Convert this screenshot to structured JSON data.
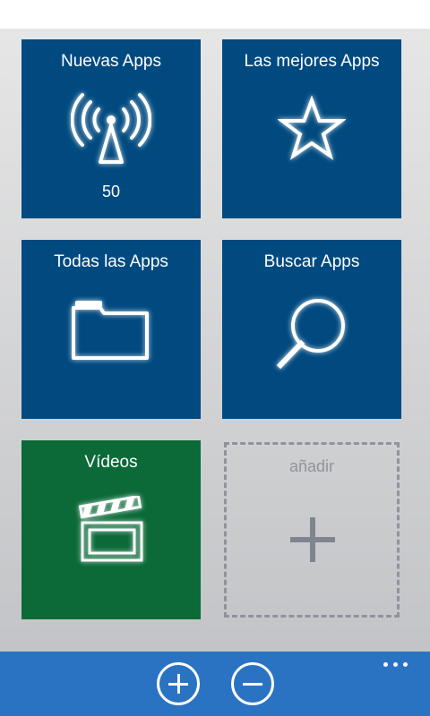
{
  "tiles": {
    "new_apps": {
      "title": "Nuevas Apps",
      "count": "50",
      "icon": "broadcast-tower-icon"
    },
    "best_apps": {
      "title": "Las mejores Apps",
      "icon": "star-icon"
    },
    "all_apps": {
      "title": "Todas las Apps",
      "icon": "folder-icon"
    },
    "search_apps": {
      "title": "Buscar Apps",
      "icon": "magnifier-icon"
    },
    "videos": {
      "title": "Vídeos",
      "icon": "clapperboard-icon"
    },
    "add": {
      "title": "añadir",
      "icon": "plus-icon"
    }
  },
  "appbar": {
    "buttons": [
      {
        "icon": "add-circle-icon"
      },
      {
        "icon": "remove-circle-icon"
      }
    ],
    "more_icon": "ellipsis-icon"
  },
  "colors": {
    "tile_blue": "#004a80",
    "tile_green": "#0b6a38",
    "appbar_blue": "#2a73c2",
    "placeholder_gray": "#8f949c"
  }
}
